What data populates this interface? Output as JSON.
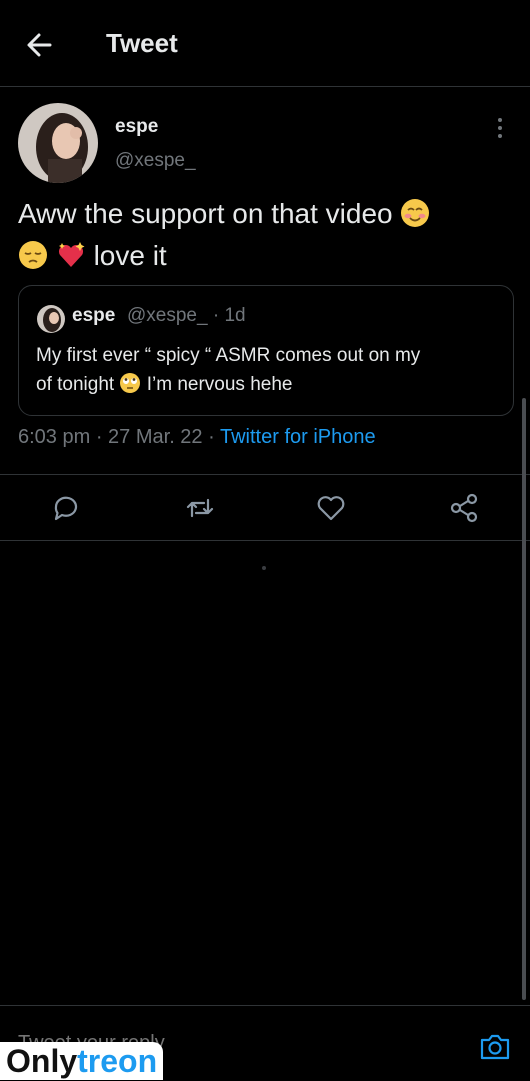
{
  "header": {
    "title": "Tweet"
  },
  "tweet": {
    "author": {
      "name": "espe",
      "handle": "@xespe_"
    },
    "text_line1": "Aww the support on that video",
    "text_line2": "love it",
    "meta": {
      "time": "6:03 pm",
      "sep1": " · ",
      "date": "27 Mar. 22",
      "sep2": " · ",
      "source": "Twitter for iPhone"
    }
  },
  "quote": {
    "name": "espe",
    "handle": "@xespe_",
    "age": "· 1d",
    "line1": "My first ever “ spicy “ ASMR comes out on my",
    "line2_pre": "of tonight",
    "line2_post": "I’m nervous hehe"
  },
  "reply": {
    "placeholder": "Tweet your reply"
  },
  "watermark": {
    "part1": "Only",
    "part2": "treon"
  },
  "icons": [
    "back-arrow-icon",
    "more-vertical-icon",
    "reply-icon",
    "retweet-icon",
    "like-icon",
    "share-icon",
    "camera-icon"
  ],
  "colors": {
    "accent": "#1d9bf0",
    "text": "#e7e9ea",
    "muted": "#71767b",
    "border": "#2f3336"
  }
}
